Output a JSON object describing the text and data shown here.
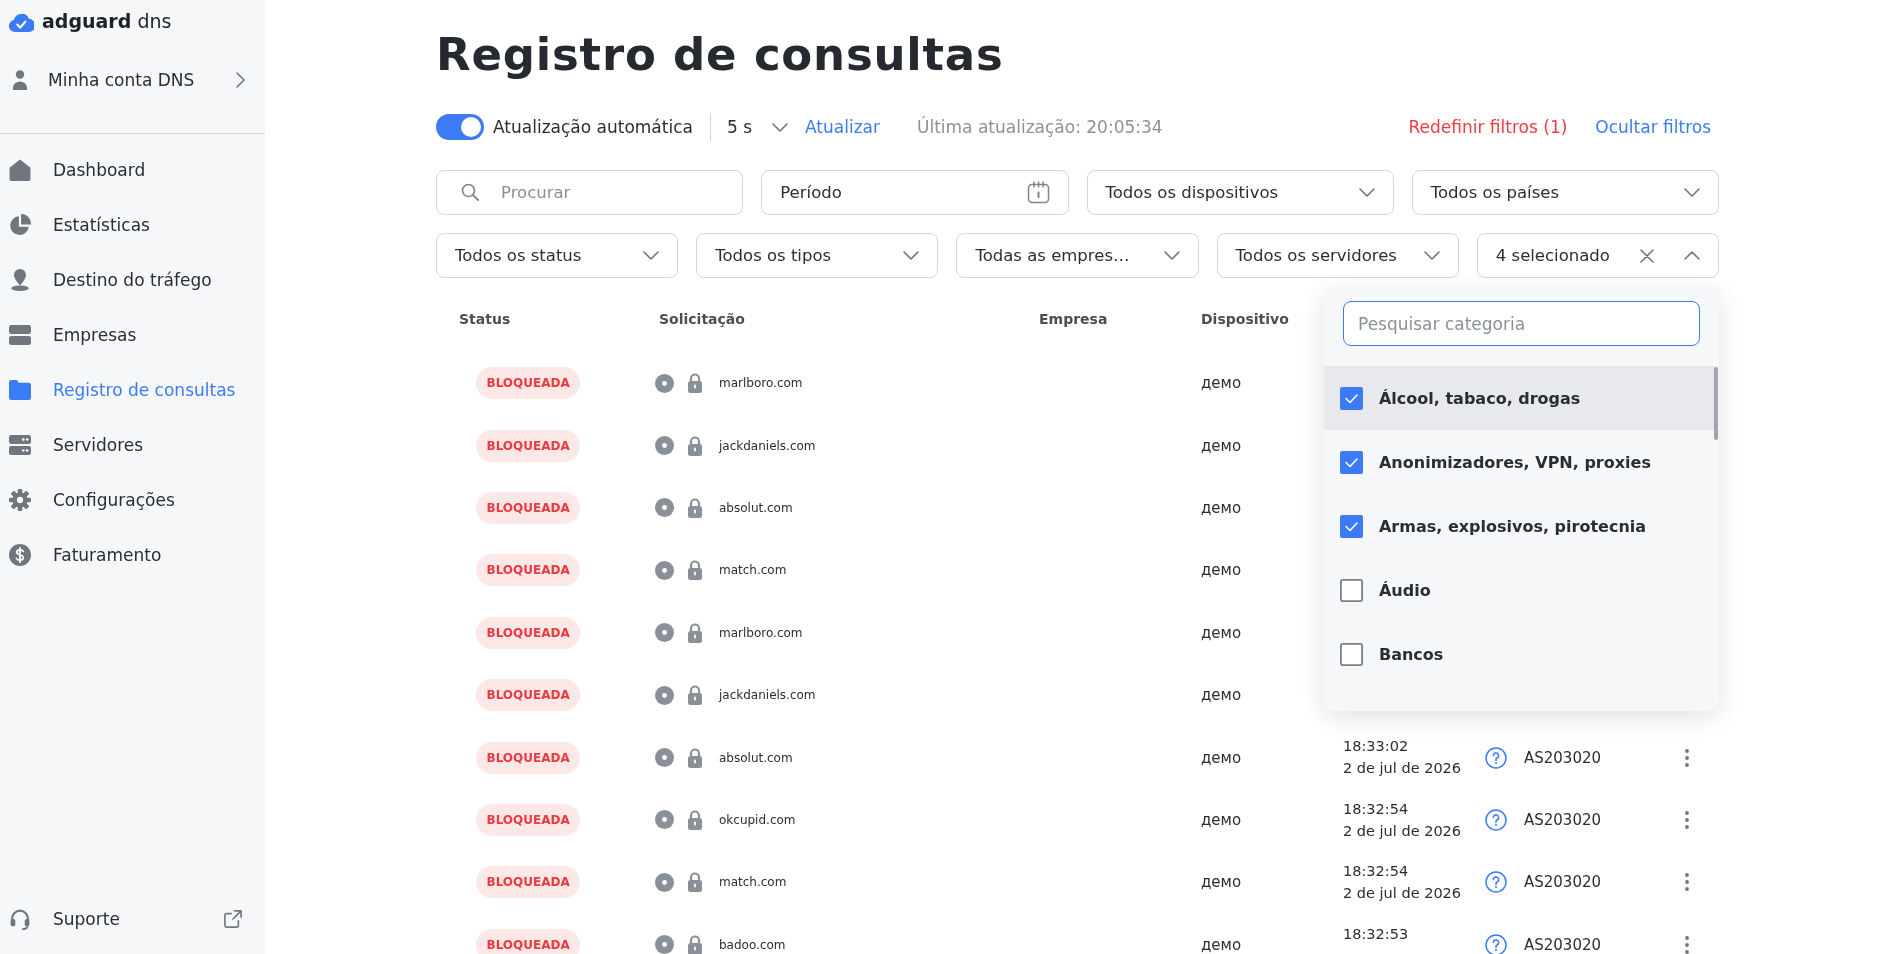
{
  "sidebar": {
    "logo": "**adguard** dns",
    "account": "Minha conta DNS",
    "items": [
      {
        "label": "Dashboard",
        "selected": false
      },
      {
        "label": "Estatísticas",
        "selected": false
      },
      {
        "label": "Destino do tráfego",
        "selected": false
      },
      {
        "label": "Empresas",
        "selected": false
      },
      {
        "label": "Registro de consultas",
        "selected": true
      },
      {
        "label": "Servidores",
        "selected": false
      },
      {
        "label": "Configurações",
        "selected": false
      },
      {
        "label": "Faturamento",
        "selected": false
      }
    ],
    "support": "Suporte"
  },
  "page": {
    "title": "Registro de consultas"
  },
  "toolbar": {
    "auto_refresh": {
      "label": "Atualização automática",
      "on": true
    },
    "interval": "5 s",
    "refresh": "Atualizar",
    "last_update": "Última atualização: 20:05:34",
    "reset_filters": "Redefinir filtros (1)",
    "hide_filters": "Ocultar filtros"
  },
  "filters": {
    "search": {
      "placeholder": "Procurar"
    },
    "period": {
      "value": "Período"
    },
    "selects": [
      {
        "value": "Todos os dispositivos",
        "kind": "single",
        "expanded": false
      },
      {
        "value": "Todos os países",
        "kind": "single",
        "expanded": false
      },
      {
        "value": "Todos os status",
        "kind": "single",
        "expanded": false
      },
      {
        "value": "Todos os tipos",
        "kind": "single",
        "expanded": false
      },
      {
        "value": "Todas as empres…",
        "kind": "single",
        "expanded": false
      },
      {
        "value": "Todos os servidores",
        "kind": "single",
        "expanded": false
      },
      {
        "value": "4 selecionado",
        "kind": "multi",
        "expanded": true,
        "menu": {
          "search": {
            "placeholder": "Pesquisar categoria",
            "focused": true
          },
          "options": [
            {
              "label": "Álcool, tabaco, drogas",
              "checked": true,
              "highlighted": true
            },
            {
              "label": "Anonimizadores, VPN, proxies",
              "checked": true,
              "highlighted": false
            },
            {
              "label": "Armas, explosivos, pirotecnia",
              "checked": true,
              "highlighted": false
            },
            {
              "label": "Áudio",
              "checked": false,
              "highlighted": false
            },
            {
              "label": "Bancos",
              "checked": false,
              "highlighted": false
            }
          ]
        }
      }
    ]
  },
  "table": {
    "columns": [
      "Status",
      "Solicitação",
      "Empresa",
      "Dispositivo"
    ],
    "rows": [
      {
        "status": "BLOQUEADA",
        "domain": "marlboro.com",
        "device": "демо"
      },
      {
        "status": "BLOQUEADA",
        "domain": "jackdaniels.com",
        "device": "демо"
      },
      {
        "status": "BLOQUEADA",
        "domain": "absolut.com",
        "device": "демо"
      },
      {
        "status": "BLOQUEADA",
        "domain": "match.com",
        "device": "демо"
      },
      {
        "status": "BLOQUEADA",
        "domain": "marlboro.com",
        "device": "демо"
      },
      {
        "status": "BLOQUEADA",
        "domain": "jackdaniels.com",
        "device": "демо"
      },
      {
        "status": "BLOQUEADA",
        "domain": "absolut.com",
        "device": "демо",
        "time": "18:33:02",
        "date": "2 de jul de 2026",
        "asn": "AS203020"
      },
      {
        "status": "BLOQUEADA",
        "domain": "okcupid.com",
        "device": "демо",
        "time": "18:32:54",
        "date": "2 de jul de 2026",
        "asn": "AS203020"
      },
      {
        "status": "BLOQUEADA",
        "domain": "match.com",
        "device": "демо",
        "time": "18:32:54",
        "date": "2 de jul de 2026",
        "asn": "AS203020"
      },
      {
        "status": "BLOQUEADA",
        "domain": "badoo.com",
        "device": "демо",
        "time": "18:32:53",
        "asn": "AS203020"
      }
    ]
  }
}
